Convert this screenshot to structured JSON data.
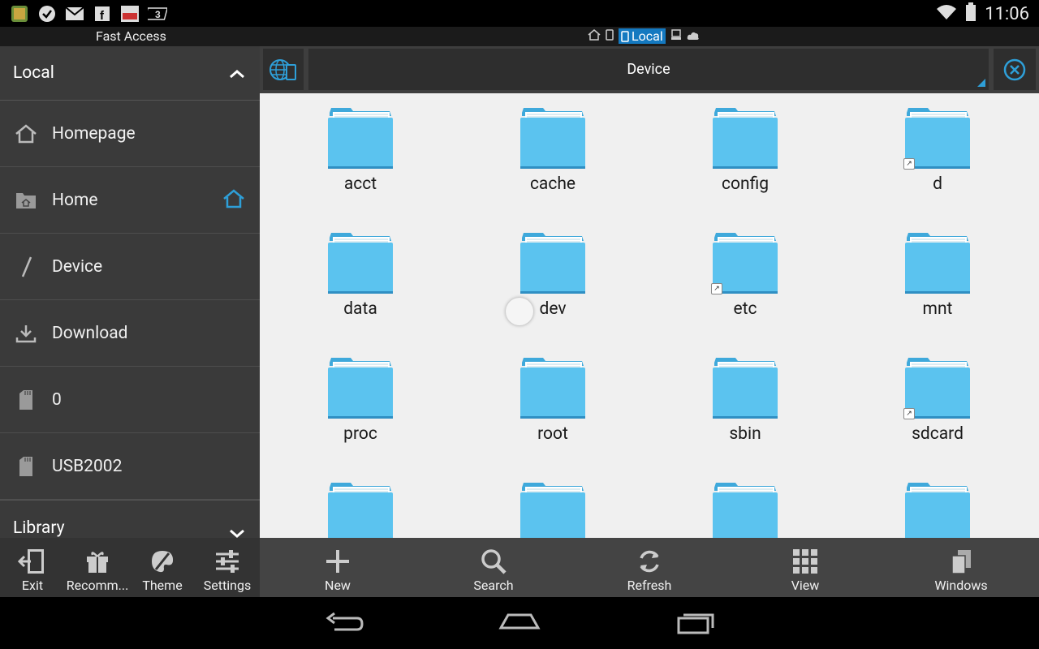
{
  "status_bar": {
    "time": "11:06",
    "notification_icons": [
      "app-icon",
      "check-icon",
      "gmail-icon",
      "facebook-icon",
      "news-icon",
      "number3-icon"
    ]
  },
  "subheader": {
    "title": "Fast Access",
    "active_tab": "Local"
  },
  "sidebar": {
    "section_title": "Local",
    "items": [
      {
        "label": "Homepage",
        "icon": "home-outline-icon"
      },
      {
        "label": "Home",
        "icon": "folder-home-icon"
      },
      {
        "label": "Device",
        "icon": "slash-icon"
      },
      {
        "label": "Download",
        "icon": "download-icon"
      },
      {
        "label": "0",
        "icon": "sdcard-icon"
      },
      {
        "label": "USB2002",
        "icon": "sdcard-icon"
      }
    ],
    "library_title": "Library"
  },
  "toolbar": {
    "path": "Device"
  },
  "folders": [
    {
      "name": "acct",
      "link": false
    },
    {
      "name": "cache",
      "link": false
    },
    {
      "name": "config",
      "link": false
    },
    {
      "name": "d",
      "link": true
    },
    {
      "name": "data",
      "link": false
    },
    {
      "name": "dev",
      "link": false
    },
    {
      "name": "etc",
      "link": true
    },
    {
      "name": "mnt",
      "link": false
    },
    {
      "name": "proc",
      "link": false
    },
    {
      "name": "root",
      "link": false
    },
    {
      "name": "sbin",
      "link": false
    },
    {
      "name": "sdcard",
      "link": true
    },
    {
      "name": "",
      "link": false
    },
    {
      "name": "",
      "link": false
    },
    {
      "name": "",
      "link": false
    },
    {
      "name": "",
      "link": false
    }
  ],
  "side_actions": [
    {
      "label": "Exit",
      "icon": "exit-icon"
    },
    {
      "label": "Recomm...",
      "icon": "gift-icon"
    },
    {
      "label": "Theme",
      "icon": "palette-icon"
    },
    {
      "label": "Settings",
      "icon": "sliders-icon"
    }
  ],
  "main_actions": [
    {
      "label": "New",
      "icon": "plus-icon"
    },
    {
      "label": "Search",
      "icon": "search-icon"
    },
    {
      "label": "Refresh",
      "icon": "refresh-icon"
    },
    {
      "label": "View",
      "icon": "grid-icon"
    },
    {
      "label": "Windows",
      "icon": "windows-icon"
    }
  ],
  "colors": {
    "accent": "#2e9fd8",
    "folder": "#5bc3ef",
    "sidebar_bg": "#3a3a3a",
    "grid_bg": "#f0f0f0"
  }
}
